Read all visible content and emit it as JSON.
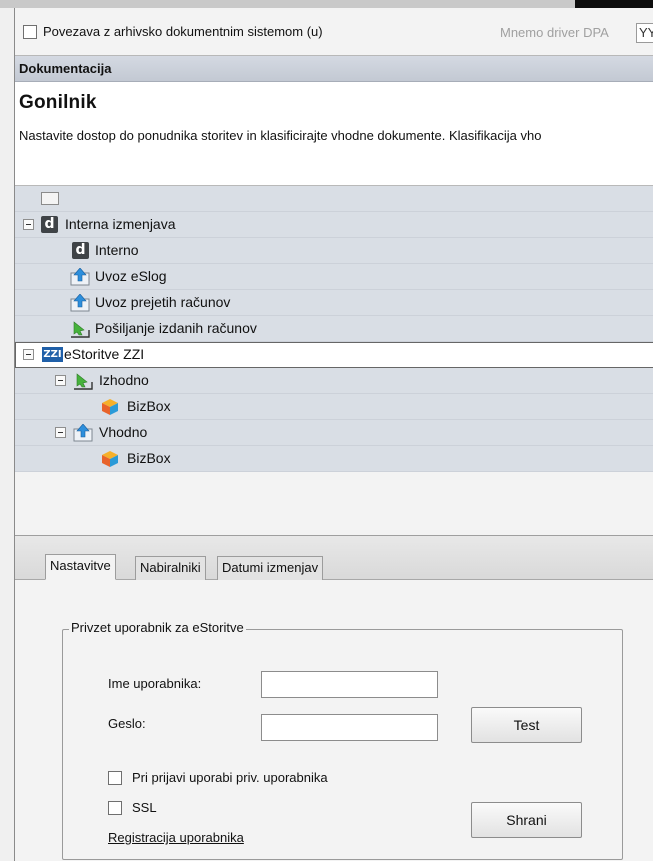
{
  "top": {
    "archive_checkbox_label": "Povezava z arhivsko dokumentnim sistemom (u)",
    "mnemo_label": "Mnemo driver DPA",
    "mnemo_value": "YY"
  },
  "section": {
    "title": "Dokumentacija"
  },
  "info": {
    "title": "Gonilnik",
    "description": "Nastavite dostop do ponudnika storitev in klasificirajte vhodne dokumente. Klasifikacija vho"
  },
  "tree": {
    "nodes": [
      {
        "label": "",
        "icon": "envelope-icon"
      },
      {
        "label": "Interna izmenjava",
        "icon": "d-logo-icon"
      },
      {
        "label": "Interno",
        "icon": "d-logo-icon"
      },
      {
        "label": "Uvoz eSlog",
        "icon": "import-arrow-icon"
      },
      {
        "label": "Uvoz prejetih računov",
        "icon": "import-arrow-icon"
      },
      {
        "label": "Pošiljanje izdanih računov",
        "icon": "export-arrow-icon"
      },
      {
        "label": "eStoritve ZZI",
        "icon": "zzi-logo-icon",
        "icon_text": "ZZI"
      },
      {
        "label": "Izhodno",
        "icon": "export-arrow-icon"
      },
      {
        "label": "BizBox",
        "icon": "bizbox-cube-icon"
      },
      {
        "label": "Vhodno",
        "icon": "import-arrow-icon"
      },
      {
        "label": "BizBox",
        "icon": "bizbox-cube-icon"
      }
    ]
  },
  "tabs": [
    {
      "label": "Nastavitve"
    },
    {
      "label": "Nabiralniki"
    },
    {
      "label": "Datumi izmenjav"
    }
  ],
  "form": {
    "group_label": "Privzet uporabnik za eStoritve",
    "username_label": "Ime uporabnika:",
    "username_value": "",
    "password_label": "Geslo:",
    "password_value": "",
    "test_button": "Test",
    "priv_user_checkbox": "Pri prijavi uporabi priv. uporabnika",
    "ssl_checkbox": "SSL",
    "save_button": "Shrani",
    "register_link": "Registracija uporabnika"
  }
}
